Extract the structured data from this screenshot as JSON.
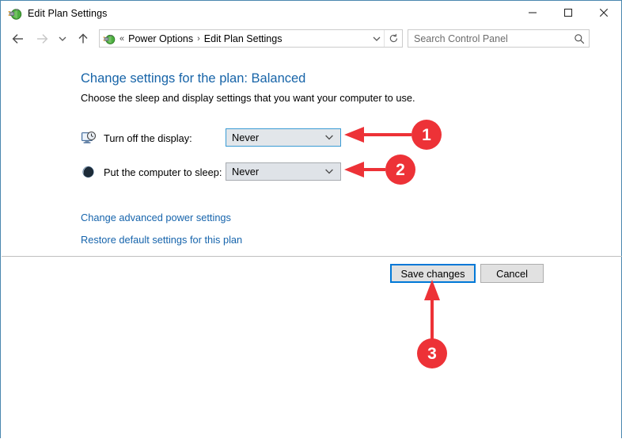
{
  "window": {
    "title": "Edit Plan Settings",
    "icon": "power-plug-icon",
    "border_color": "#4a87af",
    "controls": {
      "minimize": "─",
      "maximize": "□",
      "close": "✕"
    }
  },
  "navbar": {
    "back": "←",
    "forward": "→",
    "recent": "⌄",
    "up": "↑",
    "address": {
      "icon": "power-plug-icon",
      "overflow": "«",
      "crumbs": [
        "Power Options",
        "Edit Plan Settings"
      ],
      "separator": "›",
      "chevron": "⌄",
      "refresh": "↻"
    },
    "search": {
      "placeholder": "Search Control Panel",
      "value": "",
      "icon": "search-icon"
    }
  },
  "content": {
    "title": "Change settings for the plan: Balanced",
    "subtitle": "Choose the sleep and display settings that you want your computer to use.",
    "settings": [
      {
        "icon": "display-clock-icon",
        "label": "Turn off the display:",
        "value": "Never",
        "focused": true
      },
      {
        "icon": "sleep-moon-icon",
        "label": "Put the computer to sleep:",
        "value": "Never",
        "focused": false
      }
    ],
    "links": [
      "Change advanced power settings",
      "Restore default settings for this plan"
    ]
  },
  "footer": {
    "save_label": "Save changes",
    "cancel_label": "Cancel"
  },
  "annotations": {
    "color": "#ed3237",
    "markers": [
      {
        "number": "1",
        "points_to": "turn-off-display-combo"
      },
      {
        "number": "2",
        "points_to": "put-computer-to-sleep-combo"
      },
      {
        "number": "3",
        "points_to": "save-changes-button"
      }
    ]
  },
  "colors": {
    "link": "#1664ac",
    "heading": "#1764a8",
    "focus_blue": "#0078d7",
    "annotation_red": "#ed3237"
  }
}
